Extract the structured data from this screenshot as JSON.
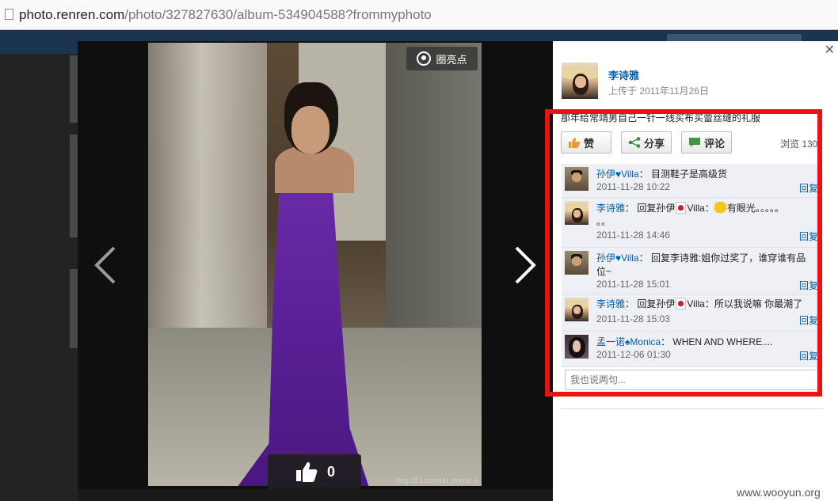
{
  "browser": {
    "url_host": "photo.renren.com",
    "url_path": "/photo/327827630/album-534904588?frommyphoto"
  },
  "viewer": {
    "highlight_label": "圈亮点",
    "like_count": "0",
    "watermark": "blog.163.com/un_prince.si"
  },
  "panel": {
    "author": "李诗雅",
    "upload_date": "上传于 2011年11月26日",
    "description": "那年给常靖男自己一针一线买布买蕾丝缝的礼服",
    "like_label": "赞",
    "share_label": "分享",
    "comment_label": "评论",
    "views": "浏览 130",
    "reply_label": "回复",
    "input_placeholder": "我也说两句...",
    "comments": [
      {
        "name": "孙伊♥Villa",
        "sep": "：",
        "text": "目测鞋子是高级货",
        "time": "2011-11-28 10:22"
      },
      {
        "name": "李诗雅",
        "sep": "：",
        "text_a": "回复孙伊",
        "text_b": "Villa：",
        "text_c": "有眼光。。。。。",
        "text_d": "。。",
        "time": "2011-11-28 14:46"
      },
      {
        "name": "孙伊♥Villa",
        "sep": "：",
        "text": "回复李诗雅:姐你过奖了，谁穿谁有品",
        "text2": "位~",
        "time": "2011-11-28 15:01"
      },
      {
        "name": "李诗雅",
        "sep": "：",
        "text_a": "回复孙伊",
        "text_b": "Villa：所以我说嘛 你最潮了",
        "time": "2011-11-28 15:03"
      },
      {
        "name": "孟一诺♠Monica",
        "sep": "：",
        "text": "WHEN AND WHERE....",
        "time": "2011-12-06 01:30"
      }
    ]
  },
  "footer": {
    "watermark": "www.wooyun.org"
  }
}
